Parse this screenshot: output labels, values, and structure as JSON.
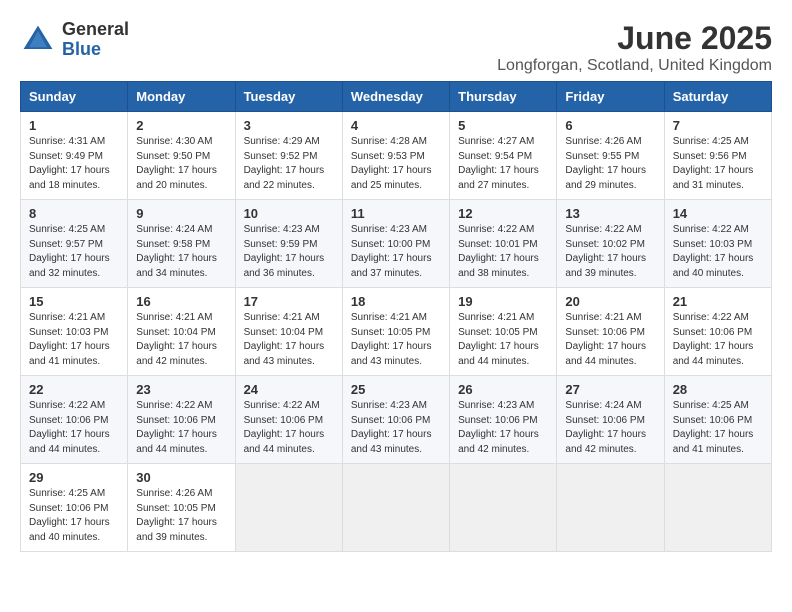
{
  "logo": {
    "general": "General",
    "blue": "Blue"
  },
  "title": "June 2025",
  "subtitle": "Longforgan, Scotland, United Kingdom",
  "days_of_week": [
    "Sunday",
    "Monday",
    "Tuesday",
    "Wednesday",
    "Thursday",
    "Friday",
    "Saturday"
  ],
  "weeks": [
    [
      {
        "day": "1",
        "info": "Sunrise: 4:31 AM\nSunset: 9:49 PM\nDaylight: 17 hours and 18 minutes."
      },
      {
        "day": "2",
        "info": "Sunrise: 4:30 AM\nSunset: 9:50 PM\nDaylight: 17 hours and 20 minutes."
      },
      {
        "day": "3",
        "info": "Sunrise: 4:29 AM\nSunset: 9:52 PM\nDaylight: 17 hours and 22 minutes."
      },
      {
        "day": "4",
        "info": "Sunrise: 4:28 AM\nSunset: 9:53 PM\nDaylight: 17 hours and 25 minutes."
      },
      {
        "day": "5",
        "info": "Sunrise: 4:27 AM\nSunset: 9:54 PM\nDaylight: 17 hours and 27 minutes."
      },
      {
        "day": "6",
        "info": "Sunrise: 4:26 AM\nSunset: 9:55 PM\nDaylight: 17 hours and 29 minutes."
      },
      {
        "day": "7",
        "info": "Sunrise: 4:25 AM\nSunset: 9:56 PM\nDaylight: 17 hours and 31 minutes."
      }
    ],
    [
      {
        "day": "8",
        "info": "Sunrise: 4:25 AM\nSunset: 9:57 PM\nDaylight: 17 hours and 32 minutes."
      },
      {
        "day": "9",
        "info": "Sunrise: 4:24 AM\nSunset: 9:58 PM\nDaylight: 17 hours and 34 minutes."
      },
      {
        "day": "10",
        "info": "Sunrise: 4:23 AM\nSunset: 9:59 PM\nDaylight: 17 hours and 36 minutes."
      },
      {
        "day": "11",
        "info": "Sunrise: 4:23 AM\nSunset: 10:00 PM\nDaylight: 17 hours and 37 minutes."
      },
      {
        "day": "12",
        "info": "Sunrise: 4:22 AM\nSunset: 10:01 PM\nDaylight: 17 hours and 38 minutes."
      },
      {
        "day": "13",
        "info": "Sunrise: 4:22 AM\nSunset: 10:02 PM\nDaylight: 17 hours and 39 minutes."
      },
      {
        "day": "14",
        "info": "Sunrise: 4:22 AM\nSunset: 10:03 PM\nDaylight: 17 hours and 40 minutes."
      }
    ],
    [
      {
        "day": "15",
        "info": "Sunrise: 4:21 AM\nSunset: 10:03 PM\nDaylight: 17 hours and 41 minutes."
      },
      {
        "day": "16",
        "info": "Sunrise: 4:21 AM\nSunset: 10:04 PM\nDaylight: 17 hours and 42 minutes."
      },
      {
        "day": "17",
        "info": "Sunrise: 4:21 AM\nSunset: 10:04 PM\nDaylight: 17 hours and 43 minutes."
      },
      {
        "day": "18",
        "info": "Sunrise: 4:21 AM\nSunset: 10:05 PM\nDaylight: 17 hours and 43 minutes."
      },
      {
        "day": "19",
        "info": "Sunrise: 4:21 AM\nSunset: 10:05 PM\nDaylight: 17 hours and 44 minutes."
      },
      {
        "day": "20",
        "info": "Sunrise: 4:21 AM\nSunset: 10:06 PM\nDaylight: 17 hours and 44 minutes."
      },
      {
        "day": "21",
        "info": "Sunrise: 4:22 AM\nSunset: 10:06 PM\nDaylight: 17 hours and 44 minutes."
      }
    ],
    [
      {
        "day": "22",
        "info": "Sunrise: 4:22 AM\nSunset: 10:06 PM\nDaylight: 17 hours and 44 minutes."
      },
      {
        "day": "23",
        "info": "Sunrise: 4:22 AM\nSunset: 10:06 PM\nDaylight: 17 hours and 44 minutes."
      },
      {
        "day": "24",
        "info": "Sunrise: 4:22 AM\nSunset: 10:06 PM\nDaylight: 17 hours and 44 minutes."
      },
      {
        "day": "25",
        "info": "Sunrise: 4:23 AM\nSunset: 10:06 PM\nDaylight: 17 hours and 43 minutes."
      },
      {
        "day": "26",
        "info": "Sunrise: 4:23 AM\nSunset: 10:06 PM\nDaylight: 17 hours and 42 minutes."
      },
      {
        "day": "27",
        "info": "Sunrise: 4:24 AM\nSunset: 10:06 PM\nDaylight: 17 hours and 42 minutes."
      },
      {
        "day": "28",
        "info": "Sunrise: 4:25 AM\nSunset: 10:06 PM\nDaylight: 17 hours and 41 minutes."
      }
    ],
    [
      {
        "day": "29",
        "info": "Sunrise: 4:25 AM\nSunset: 10:06 PM\nDaylight: 17 hours and 40 minutes."
      },
      {
        "day": "30",
        "info": "Sunrise: 4:26 AM\nSunset: 10:05 PM\nDaylight: 17 hours and 39 minutes."
      },
      null,
      null,
      null,
      null,
      null
    ]
  ]
}
